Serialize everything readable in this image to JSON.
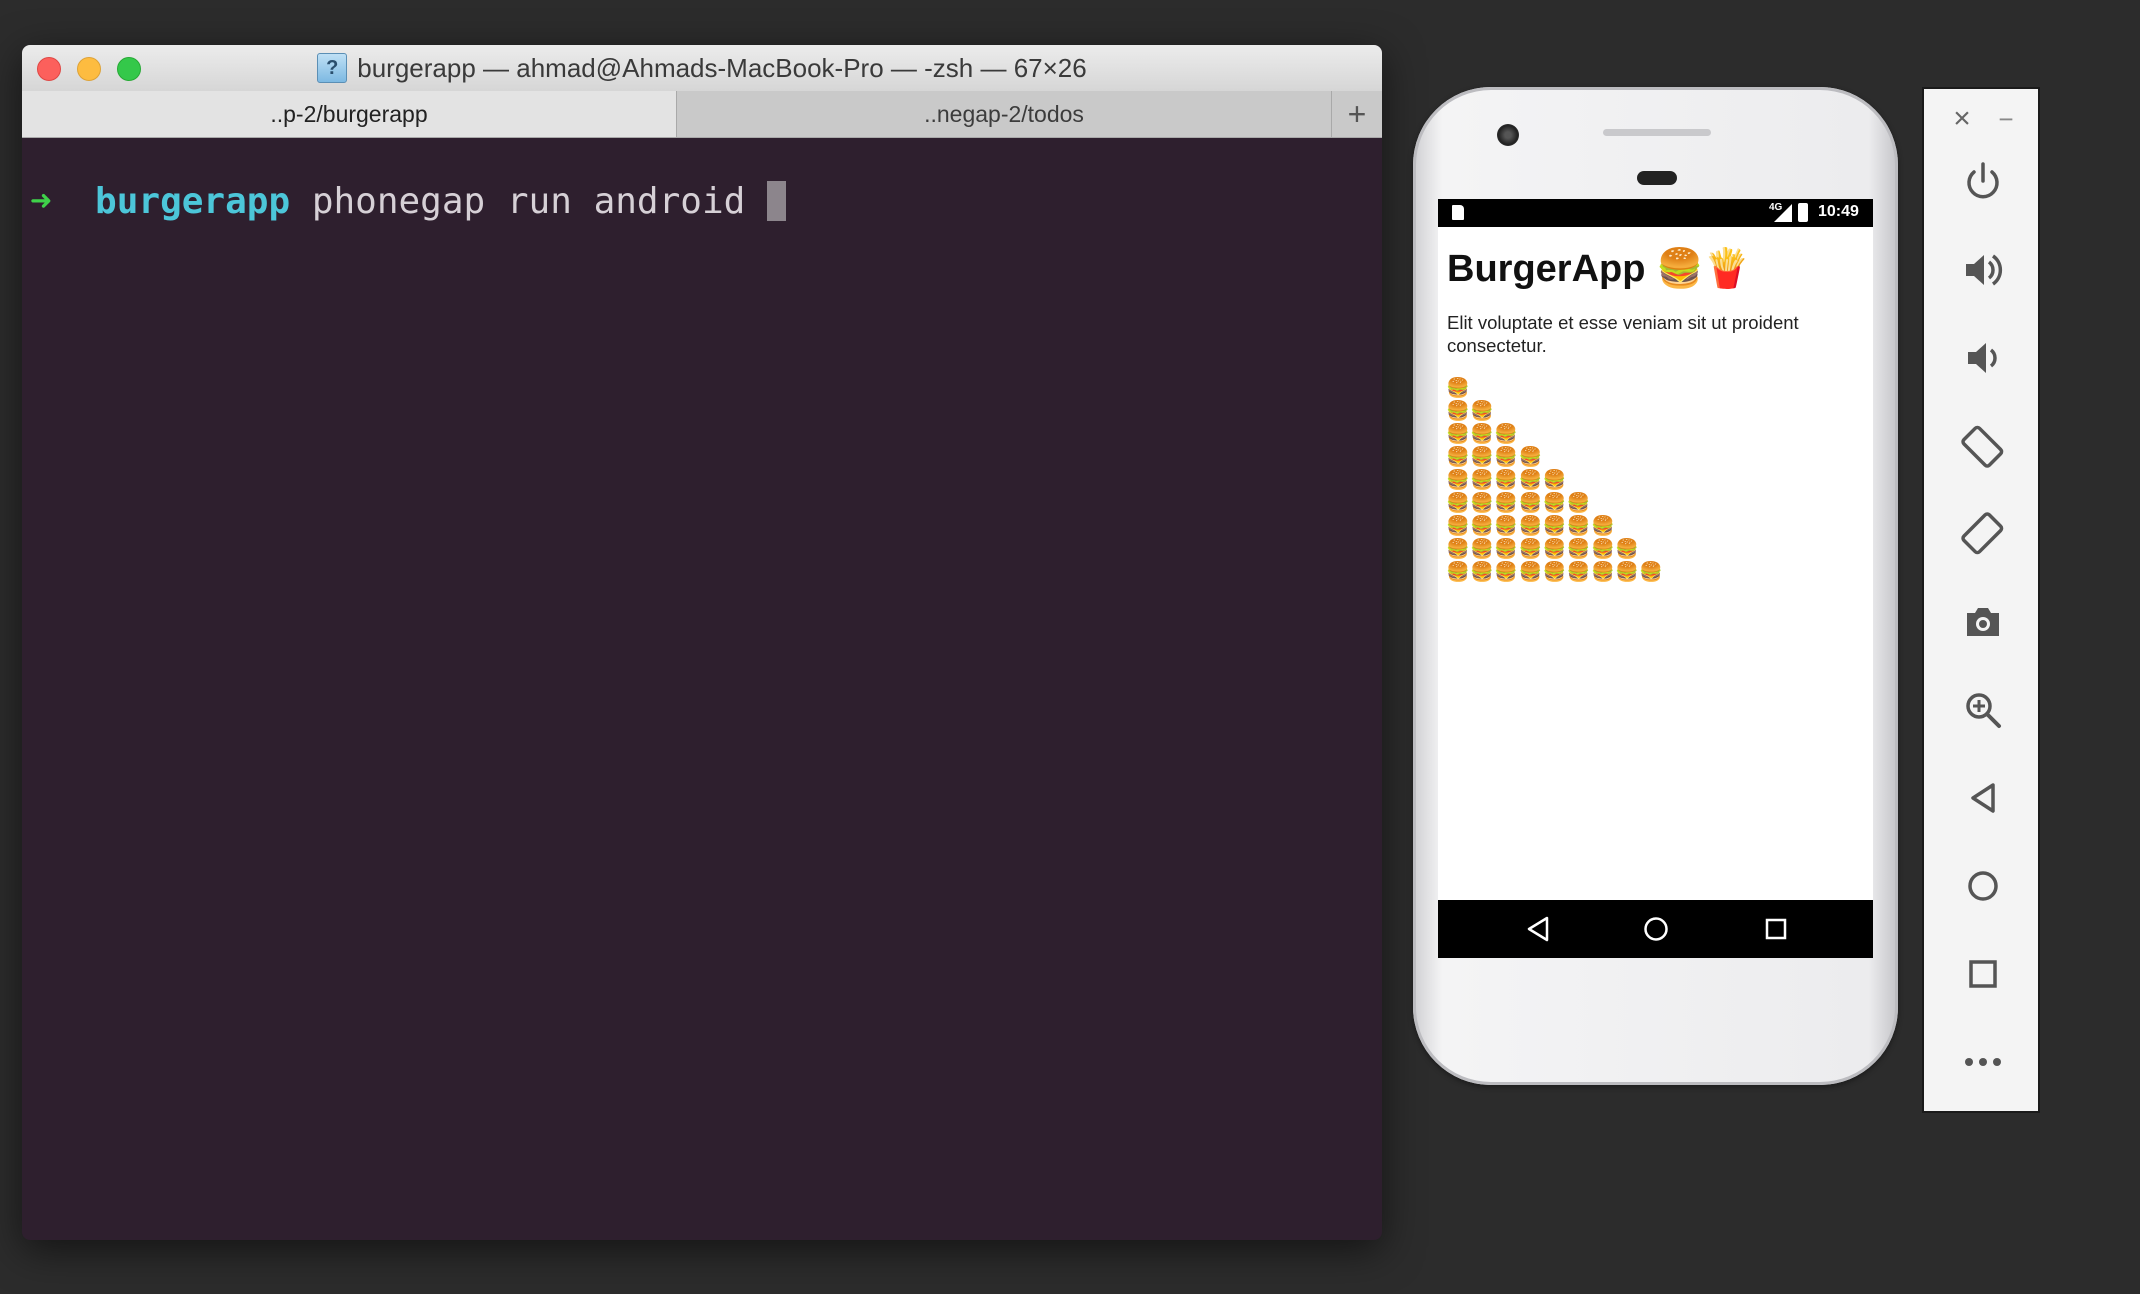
{
  "terminal": {
    "title": "burgerapp — ahmad@Ahmads-MacBook-Pro — -zsh — 67×26",
    "title_icon": "?",
    "tabs": [
      {
        "label": "..p-2/burgerapp",
        "active": true
      },
      {
        "label": "..negap-2/todos",
        "active": false
      }
    ],
    "add_tab_label": "+",
    "prompt": {
      "arrow": "➜",
      "directory": "burgerapp",
      "command": "phonegap run android"
    },
    "colors": {
      "background": "#2e1f2e",
      "arrow": "#3fd14a",
      "directory": "#4cc6d9",
      "command": "#d6d0d6"
    }
  },
  "phone": {
    "status_bar": {
      "network": "4G",
      "time": "10:49"
    },
    "app": {
      "title": "BurgerApp 🍔🍟",
      "description": "Elit voluptate et esse veniam sit ut proident consectetur.",
      "burger_rows": [
        "🍔",
        "🍔🍔",
        "🍔🍔🍔",
        "🍔🍔🍔🍔",
        "🍔🍔🍔🍔🍔",
        "🍔🍔🍔🍔🍔🍔",
        "🍔🍔🍔🍔🍔🍔🍔",
        "🍔🍔🍔🍔🍔🍔🍔🍔",
        "🍔🍔🍔🍔🍔🍔🍔🍔🍔"
      ]
    },
    "nav_buttons": [
      "back-icon",
      "home-icon",
      "recents-icon"
    ]
  },
  "emulator_toolbar": {
    "close_label": "×",
    "minimize_label": "−",
    "buttons": [
      "power-icon",
      "volume-up-icon",
      "volume-down-icon",
      "rotate-left-icon",
      "rotate-right-icon",
      "camera-icon",
      "zoom-icon",
      "back-icon",
      "home-icon",
      "overview-icon",
      "more-icon"
    ]
  }
}
